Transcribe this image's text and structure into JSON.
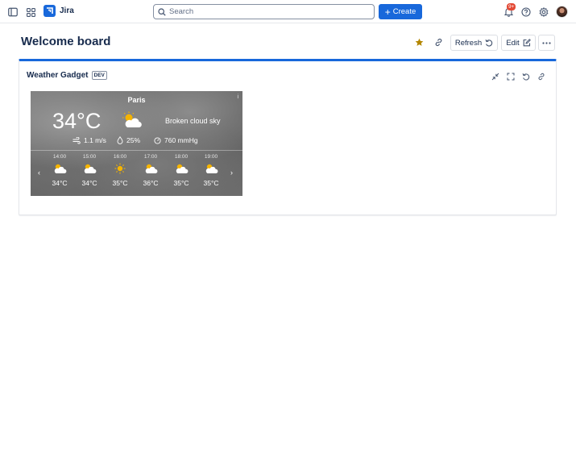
{
  "topbar": {
    "app_name": "Jira",
    "search_placeholder": "Search",
    "create_label": "Create",
    "notification_badge": "9+"
  },
  "page": {
    "title": "Welcome board",
    "refresh_label": "Refresh",
    "edit_label": "Edit",
    "favorite": true
  },
  "gadget": {
    "title": "Weather Gadget",
    "tag": "DEV"
  },
  "weather": {
    "city": "Paris",
    "info_glyph": "i",
    "temperature": "34°C",
    "condition_icon": "sun-cloud-icon",
    "description": "Broken cloud sky",
    "wind": "1.1 m/s",
    "humidity": "25%",
    "pressure": "760 mmHg",
    "prev_glyph": "‹",
    "next_glyph": "›",
    "hourly": [
      {
        "time": "14:00",
        "icon": "sun-cloud-icon",
        "temp": "34°C"
      },
      {
        "time": "15:00",
        "icon": "sun-cloud-icon",
        "temp": "34°C"
      },
      {
        "time": "16:00",
        "icon": "sun-icon",
        "temp": "35°C"
      },
      {
        "time": "17:00",
        "icon": "sun-cloud-icon",
        "temp": "36°C"
      },
      {
        "time": "18:00",
        "icon": "sun-cloud-icon",
        "temp": "35°C"
      },
      {
        "time": "19:00",
        "icon": "sun-cloud-icon",
        "temp": "35°C"
      }
    ]
  },
  "colors": {
    "brand": "#1868db",
    "star": "#b38600",
    "badge": "#e34935",
    "sun": "#f5b400"
  }
}
